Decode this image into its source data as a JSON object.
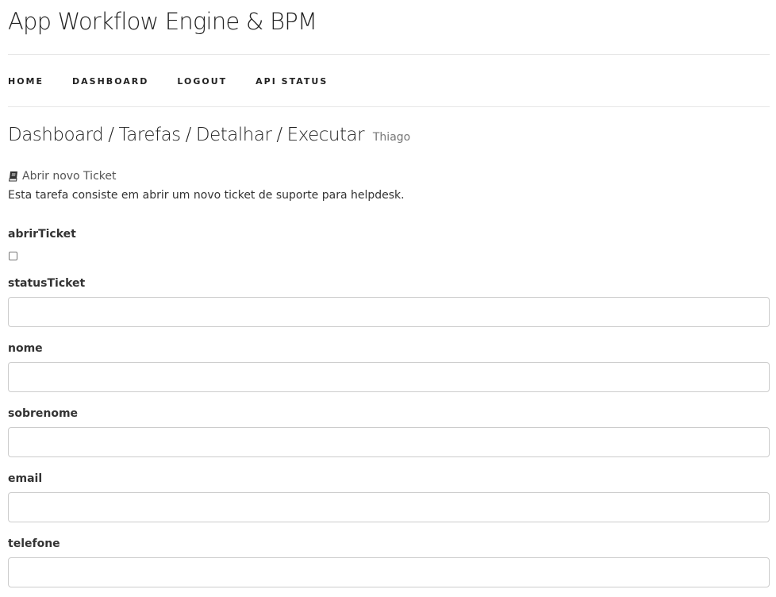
{
  "app": {
    "title": "App Workflow Engine & BPM"
  },
  "nav": {
    "items": [
      {
        "label": "HOME"
      },
      {
        "label": "DASHBOARD"
      },
      {
        "label": "LOGOUT"
      },
      {
        "label": "API STATUS"
      }
    ]
  },
  "breadcrumb": {
    "parts": [
      "Dashboard",
      "Tarefas",
      "Detalhar",
      "Executar"
    ],
    "separator": "/",
    "user": "Thiago"
  },
  "task": {
    "icon": "book-icon",
    "title": "Abrir novo Ticket",
    "description": "Esta tarefa consiste em abrir um novo ticket de suporte para helpdesk."
  },
  "form": {
    "abrirTicket": {
      "label": "abrirTicket",
      "checked": false
    },
    "statusTicket": {
      "label": "statusTicket",
      "value": ""
    },
    "nome": {
      "label": "nome",
      "value": ""
    },
    "sobrenome": {
      "label": "sobrenome",
      "value": ""
    },
    "email": {
      "label": "email",
      "value": ""
    },
    "telefone": {
      "label": "telefone",
      "value": ""
    }
  }
}
